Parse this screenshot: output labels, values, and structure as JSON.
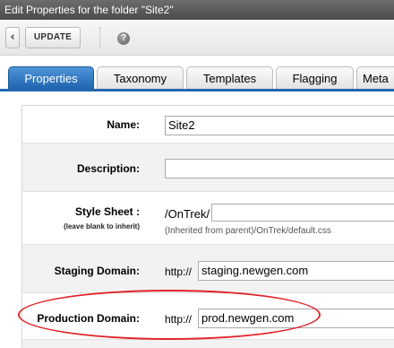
{
  "window": {
    "title": "Edit Properties for the folder \"Site2\""
  },
  "toolbar": {
    "back_glyph": "‹",
    "update_label": "UPDATE",
    "help_glyph": "?"
  },
  "tabs": [
    {
      "label": "Properties",
      "active": true
    },
    {
      "label": "Taxonomy",
      "active": false
    },
    {
      "label": "Templates",
      "active": false
    },
    {
      "label": "Flagging",
      "active": false
    },
    {
      "label": "Meta",
      "active": false
    }
  ],
  "form": {
    "name": {
      "label": "Name:",
      "value": "Site2"
    },
    "description": {
      "label": "Description:",
      "value": ""
    },
    "stylesheet": {
      "label": "Style Sheet :",
      "hint": "(leave blank to inherit)",
      "prefix": "/OnTrek/",
      "value": "",
      "inherited": "(Inherited from parent)/OnTrek/default.css"
    },
    "staging": {
      "label": "Staging Domain:",
      "prefix": "http://",
      "value": "staging.newgen.com"
    },
    "production": {
      "label": "Production Domain:",
      "prefix": "http://",
      "value": "prod.newgen.com"
    }
  },
  "colors": {
    "active_tab": "#1d62ad",
    "highlight_ellipse": "#e0262b",
    "titlebar": "#555555"
  }
}
